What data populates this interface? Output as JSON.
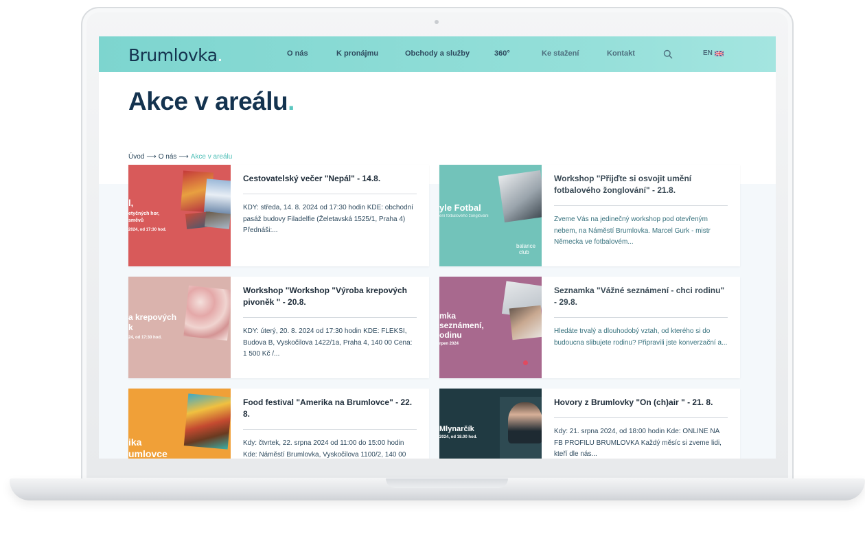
{
  "header": {
    "logo": "Brumlovka",
    "logo_dot": ".",
    "nav": [
      "O nás",
      "K pronájmu",
      "Obchody a služby",
      "360°",
      "Ke stažení",
      "Kontakt"
    ],
    "lang": "EN"
  },
  "page": {
    "title": "Akce v areálu",
    "title_dot": ".",
    "breadcrumb": {
      "home": "Úvod",
      "sep": "⟶",
      "parent": "O nás",
      "current": "Akce v areálu"
    }
  },
  "events": [
    {
      "title": "Cestovatelský večer \"Nepál\" - 14.8.",
      "text": "KDY: středa, 14. 8. 2024 od 17:30 hodin KDE: obchodní pasáž budovy Filadelfie (Želetavská 1525/1, Praha 4) Přednáši:...",
      "thumb_lines": [
        "l,",
        "etyčných hor,",
        "směvů",
        "2024, od 17:30 hod."
      ]
    },
    {
      "title": "Workshop \"Přijďte si osvojit umění fotbalového žonglování\" - 21.8.",
      "text": "Zveme Vás na jedinečný workshop pod otevřeným nebem, na Náměstí Brumlovka. Marcel Gurk - mistr Německa ve fotbalovém...",
      "thumb_lines": [
        "yle Fotbal",
        "balance",
        "club"
      ]
    },
    {
      "title": "Workshop \"Workshop \"Výroba krepových pivoněk \" - 20.8.",
      "text": "KDY: úterý, 20. 8. 2024 od 17:30 hodin KDE: FLEKSI, Budova B, Vyskočilova 1422/1a, Praha 4, 140 00 Cena: 1 500 Kč /...",
      "thumb_lines": [
        "a krepových",
        "k",
        "24, od 17:30 hod."
      ]
    },
    {
      "title": "Seznamka \"Vážné seznámení - chci rodinu\" - 29.8.",
      "text": "Hledáte trvalý a dlouhodobý vztah, od kterého si do budoucna slibujete rodinu? Připravili jste konverzační a...",
      "thumb_lines": [
        "mka",
        "seznámení,",
        "odinu",
        "rpen 2024"
      ]
    },
    {
      "title": "Food festival \"Amerika na Brumlovce\" - 22. 8.",
      "text": "Kdy: čtvrtek, 22. srpna 2024 od 11:00 do 15:00 hodin Kde: Náměstí Brumlovka, Vyskočilova 1100/2, 140 00",
      "thumb_lines": [
        "ika",
        "umlovce"
      ]
    },
    {
      "title": "Hovory z Brumlovky \"On (ch)air \" - 21. 8.",
      "text": "Kdy:  21. srpna 2024, od 18:00 hodin Kde: ONLINE NA FB PROFILU BRUMLOVKA Každý měsíc si zveme lidi, kteří dle nás...",
      "thumb_lines": [
        "Mlynarčík",
        "2024, od 18.00 hod."
      ]
    }
  ]
}
